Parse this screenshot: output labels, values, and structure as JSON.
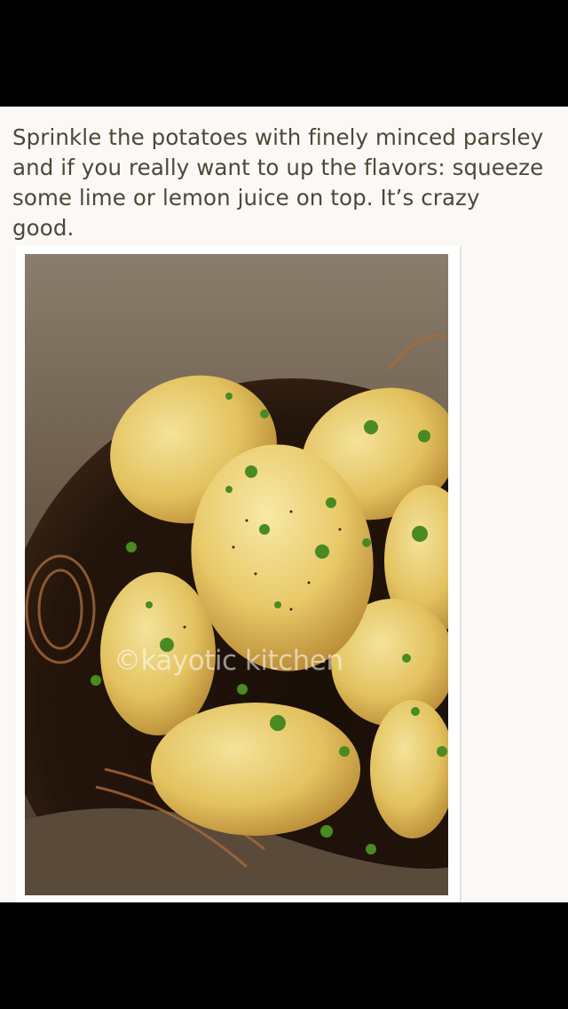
{
  "caption": "Sprinkle the potatoes with finely minced parsley and if you really want to up the flavors: squeeze some lime or lemon juice on top. It’s crazy good.",
  "photo": {
    "watermark": "©kayotic kitchen",
    "subject": "roasted-potatoes-with-parsley"
  },
  "colors": {
    "background": "#fbf9f5",
    "caption_text": "#4f4636",
    "letterbox": "#000000"
  }
}
